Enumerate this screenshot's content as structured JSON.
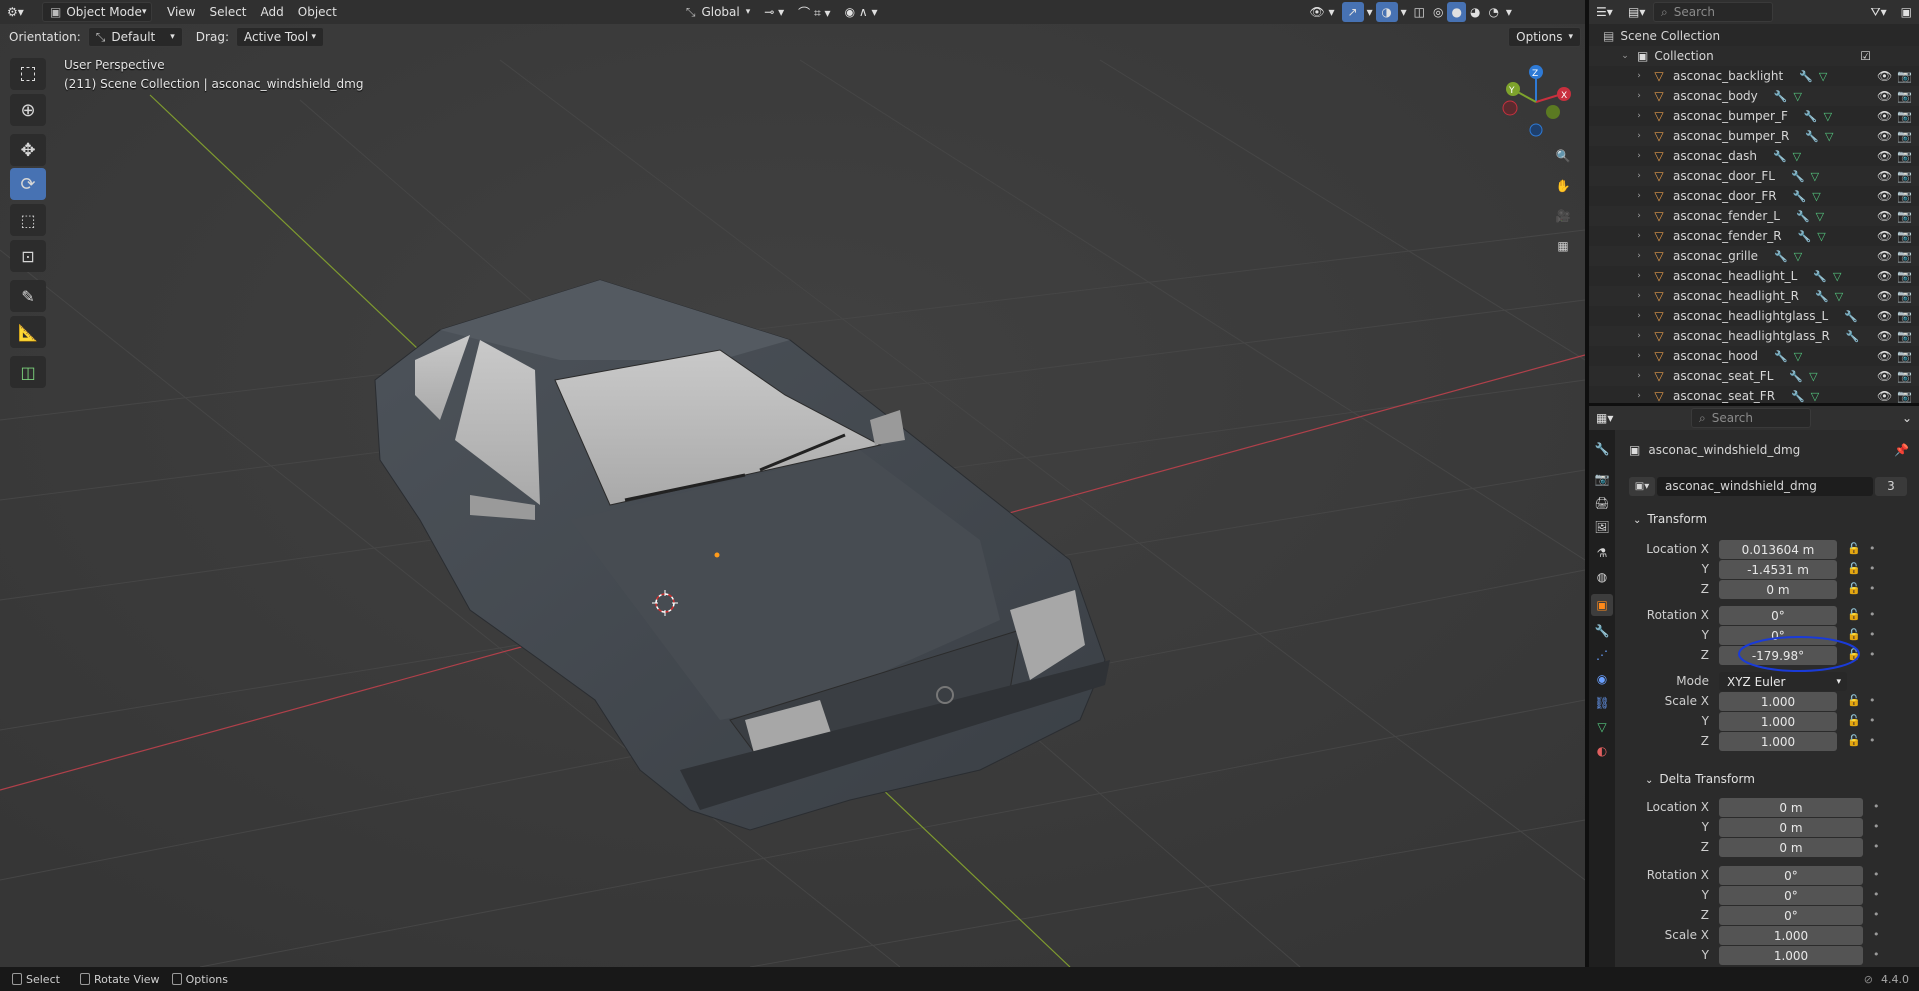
{
  "header": {
    "editor_icon": "view3d-icon",
    "mode": "Object Mode",
    "menus": [
      "View",
      "Select",
      "Add",
      "Object"
    ],
    "transform_orientation": "Global"
  },
  "tool_settings": {
    "orientation_label": "Orientation:",
    "orientation_value": "Default",
    "drag_label": "Drag:",
    "drag_value": "Active Tool",
    "options": "Options"
  },
  "viewport": {
    "perspective": "User Perspective",
    "info": "(211) Scene Collection | asconac_windshield_dmg",
    "gizmo": {
      "x": "X",
      "y": "Y",
      "z": "Z"
    }
  },
  "outliner": {
    "search_placeholder": "Search",
    "scene_collection": "Scene Collection",
    "collection": "Collection",
    "items": [
      "asconac_backlight",
      "asconac_body",
      "asconac_bumper_F",
      "asconac_bumper_R",
      "asconac_dash",
      "asconac_door_FL",
      "asconac_door_FR",
      "asconac_fender_L",
      "asconac_fender_R",
      "asconac_grille",
      "asconac_headlight_L",
      "asconac_headlight_R",
      "asconac_headlightglass_L",
      "asconac_headlightglass_R",
      "asconac_hood",
      "asconac_seat_FL",
      "asconac_seat_FR"
    ]
  },
  "properties": {
    "search_placeholder": "Search",
    "object_name": "asconac_windshield_dmg",
    "datablock_name": "asconac_windshield_dmg",
    "users": "3",
    "transform": {
      "title": "Transform",
      "location_label": "Location X",
      "location": [
        "0.013604 m",
        "-1.4531 m",
        "0 m"
      ],
      "rotation_label": "Rotation X",
      "rotation": [
        "0°",
        "0°",
        "-179.98°"
      ],
      "mode_label": "Mode",
      "mode": "XYZ Euler",
      "scale_label": "Scale X",
      "scale": [
        "1.000",
        "1.000",
        "1.000"
      ],
      "y_label": "Y",
      "z_label": "Z"
    },
    "delta": {
      "title": "Delta Transform",
      "location_label": "Location X",
      "location": [
        "0 m",
        "0 m",
        "0 m"
      ],
      "rotation_label": "Rotation X",
      "rotation": [
        "0°",
        "0°",
        "0°"
      ],
      "scale_label": "Scale X",
      "scale": [
        "1.000",
        "1.000"
      ]
    }
  },
  "status": {
    "select": "Select",
    "rotate": "Rotate View",
    "options": "Options",
    "version": "4.4.0"
  },
  "colors": {
    "accent": "#4772b3",
    "x_axis": "#c8303e",
    "y_axis": "#7ea32c",
    "z_axis": "#2e7ad6",
    "annotation": "#1a3bd8"
  }
}
